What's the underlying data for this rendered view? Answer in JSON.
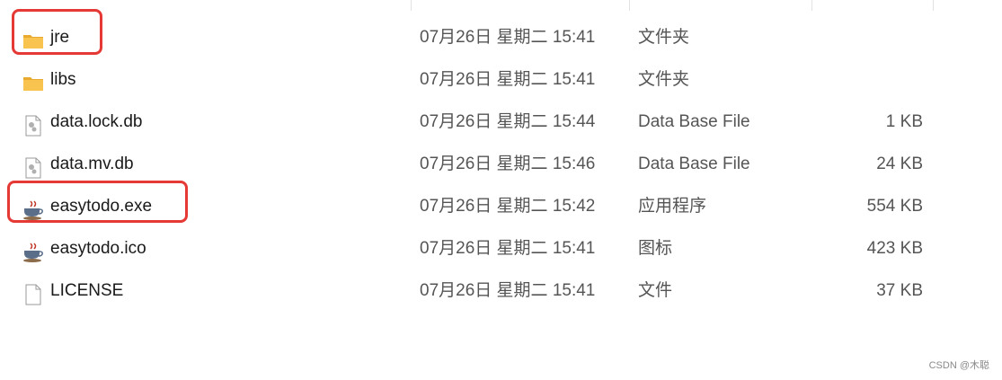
{
  "files": [
    {
      "name": "jre",
      "modified": "07月26日 星期二 15:41",
      "type": "文件夹",
      "size": "",
      "icon": "folder-icon"
    },
    {
      "name": "libs",
      "modified": "07月26日 星期二 15:41",
      "type": "文件夹",
      "size": "",
      "icon": "folder-icon"
    },
    {
      "name": "data.lock.db",
      "modified": "07月26日 星期二 15:44",
      "type": "Data Base File",
      "size": "1 KB",
      "icon": "database-file-icon"
    },
    {
      "name": "data.mv.db",
      "modified": "07月26日 星期二 15:46",
      "type": "Data Base File",
      "size": "24 KB",
      "icon": "database-file-icon"
    },
    {
      "name": "easytodo.exe",
      "modified": "07月26日 星期二 15:42",
      "type": "应用程序",
      "size": "554 KB",
      "icon": "java-cup-icon"
    },
    {
      "name": "easytodo.ico",
      "modified": "07月26日 星期二 15:41",
      "type": "图标",
      "size": "423 KB",
      "icon": "java-cup-icon"
    },
    {
      "name": "LICENSE",
      "modified": "07月26日 星期二 15:41",
      "type": "文件",
      "size": "37 KB",
      "icon": "blank-file-icon"
    }
  ],
  "watermark": "CSDN @木聪",
  "colors": {
    "highlight": "#e53935",
    "folder": "#f8c44f",
    "secondary_text": "#555555"
  }
}
